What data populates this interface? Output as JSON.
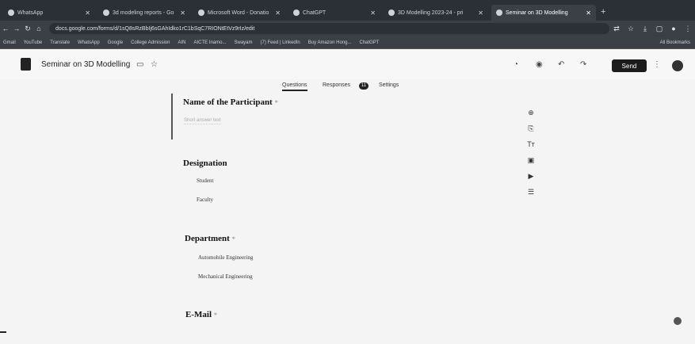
{
  "browser": {
    "tabs": [
      {
        "label": "WhatsApp",
        "active": false
      },
      {
        "label": "3d modeling reports - Go",
        "active": false
      },
      {
        "label": "Microsoft Word - Donatio",
        "active": false
      },
      {
        "label": "ChatGPT",
        "active": false
      },
      {
        "label": "3D Modelling 2023-24 - pri",
        "active": false
      },
      {
        "label": "Seminar on 3D Modelling",
        "active": true
      }
    ],
    "url": "docs.google.com/forms/d/1sQ8sRzBbIj6sGAhIdko1rC1bSqC7RIONtEtVz9rIz/edit",
    "bookmarks": [
      "Gmail",
      "YouTube",
      "Translate",
      "WhatsApp",
      "Google",
      "College Admission",
      "AIN",
      "AICTE Inamo...",
      "Swayam",
      "(7) Feed | LinkedIn",
      "Buy Amazon Hong...",
      "ChatGPT"
    ],
    "all_bookmarks": "All Bookmarks"
  },
  "form_header": {
    "title": "Seminar on 3D Modelling",
    "send_label": "Send"
  },
  "form_tabs": {
    "questions": "Questions",
    "responses": "Responses",
    "responses_count": "11",
    "settings": "Settings"
  },
  "questions": [
    {
      "title": "Name of the Participant",
      "required": "*",
      "answer_placeholder": "Short answer text"
    },
    {
      "title": "Designation",
      "options": [
        "Student",
        "Faculty"
      ]
    },
    {
      "title": "Department",
      "required": "*",
      "options": [
        "Automobile Engineering",
        "Mechanical Engineering"
      ]
    },
    {
      "title": "E-Mail",
      "required": "*"
    }
  ],
  "toolbar_icons": [
    "add-question-icon",
    "import-questions-icon",
    "add-title-icon",
    "add-image-icon",
    "add-video-icon",
    "add-section-icon"
  ],
  "toolbar_text": {
    "title_glyph": "Tт"
  }
}
